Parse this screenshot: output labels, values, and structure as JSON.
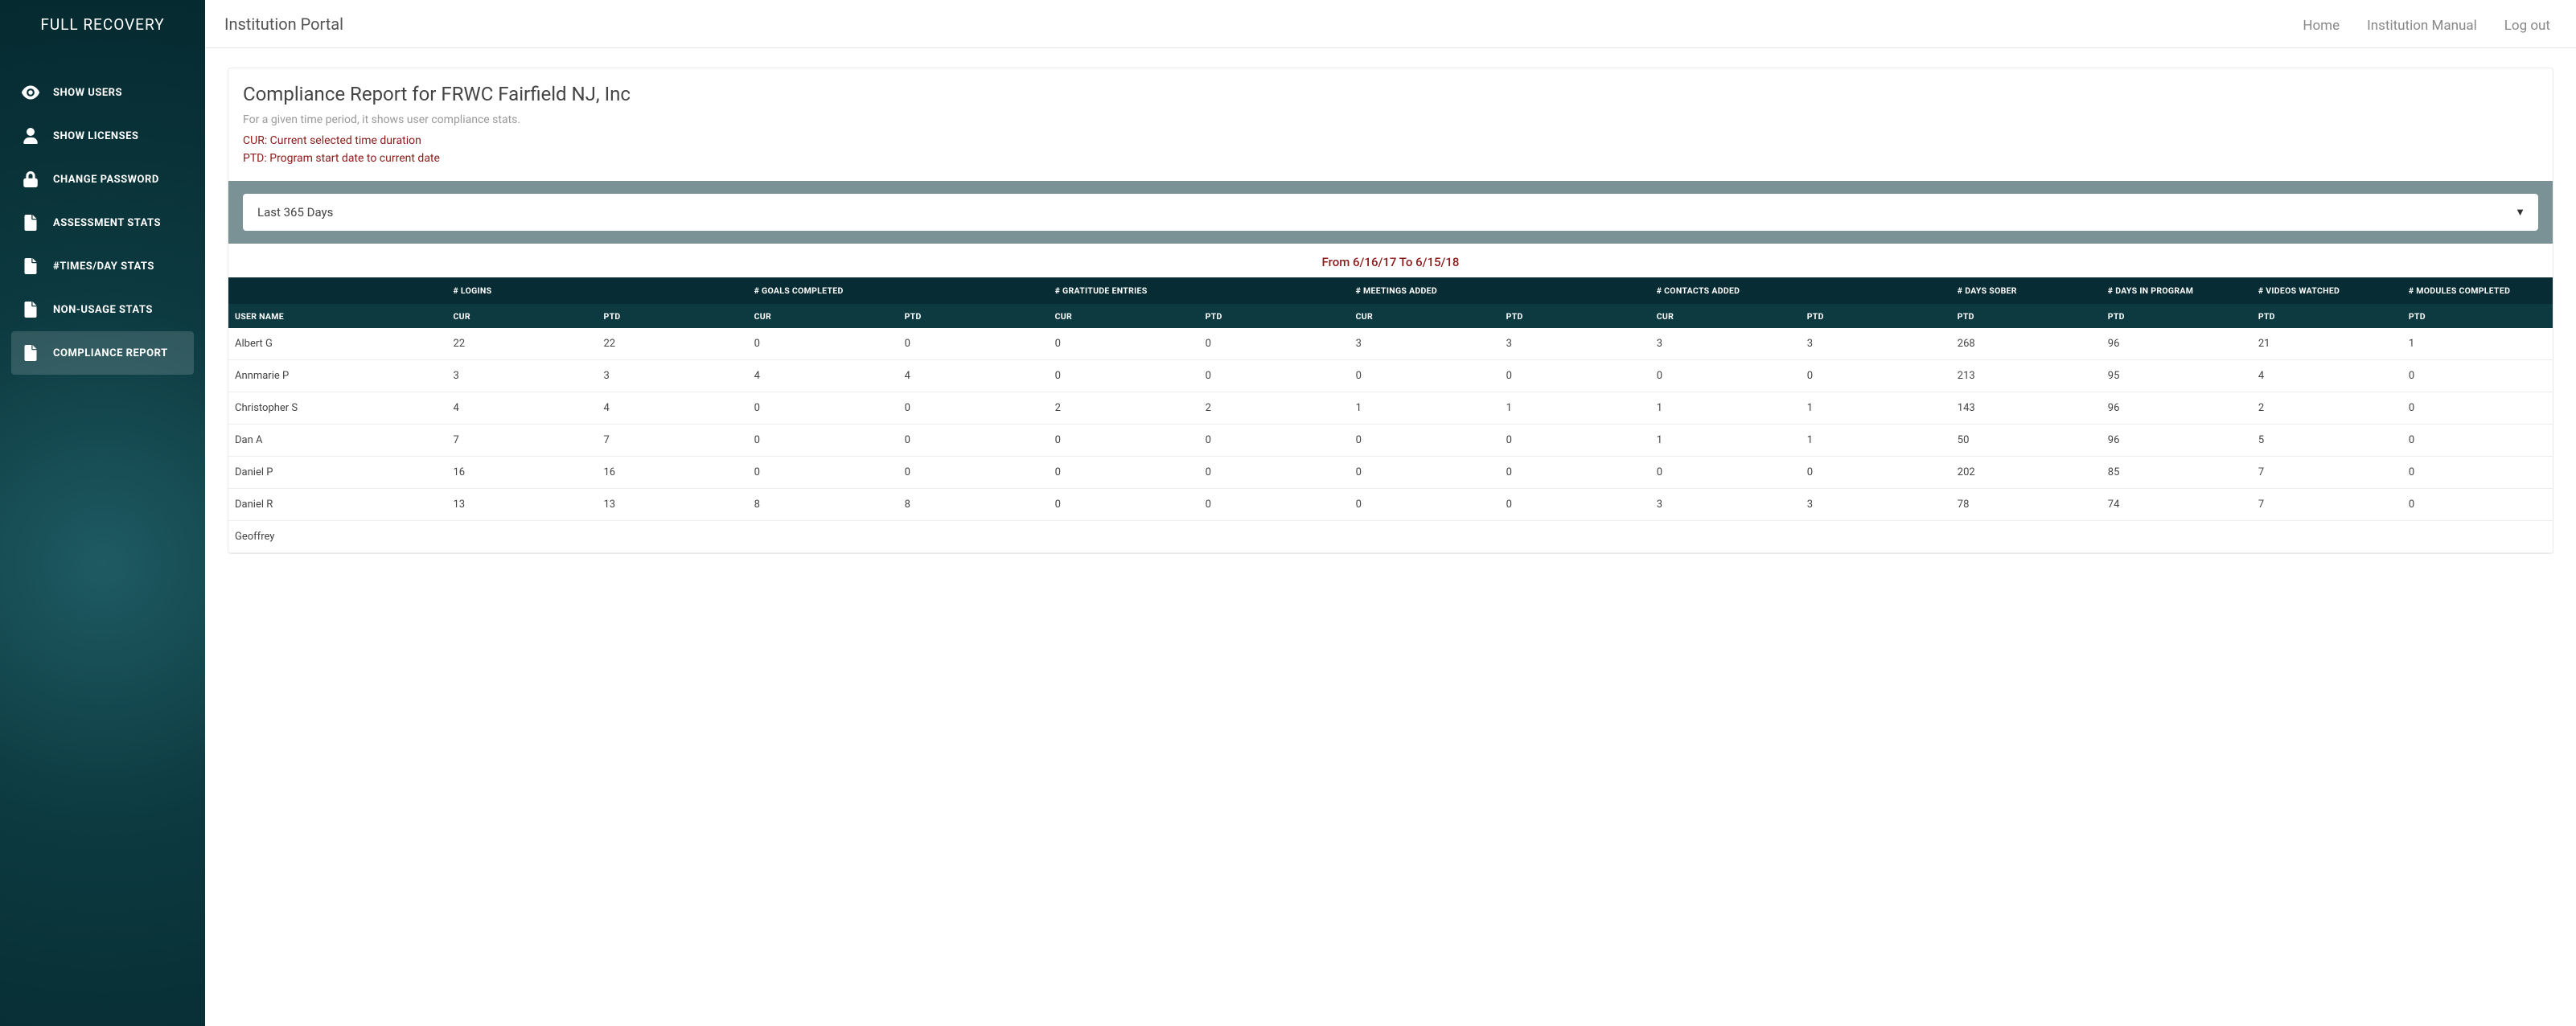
{
  "brand": "FULL RECOVERY",
  "sidebar": {
    "items": [
      {
        "label": "SHOW USERS",
        "icon": "eye-icon"
      },
      {
        "label": "SHOW LICENSES",
        "icon": "user-icon"
      },
      {
        "label": "CHANGE PASSWORD",
        "icon": "lock-icon"
      },
      {
        "label": "ASSESSMENT STATS",
        "icon": "file-icon"
      },
      {
        "label": "#TIMES/DAY STATS",
        "icon": "file-icon"
      },
      {
        "label": "NON-USAGE STATS",
        "icon": "file-icon"
      },
      {
        "label": "COMPLIANCE REPORT",
        "icon": "file-icon"
      }
    ],
    "activeIndex": 6
  },
  "topbar": {
    "title": "Institution Portal",
    "links": [
      "Home",
      "Institution Manual",
      "Log out"
    ]
  },
  "panel": {
    "title": "Compliance Report for FRWC Fairfield NJ, Inc",
    "subtitle": "For a given time period, it shows user compliance stats.",
    "legend_cur": "CUR: Current selected time duration",
    "legend_ptd": "PTD: Program start date to current date",
    "selector_value": "Last 365 Days",
    "range": "From 6/16/17 To 6/15/18"
  },
  "table": {
    "group_headers": [
      "",
      "# LOGINS",
      "# GOALS COMPLETED",
      "# GRATITUDE ENTRIES",
      "# MEETINGS ADDED",
      "# CONTACTS ADDED",
      "# DAYS SOBER",
      "# DAYS IN PROGRAM",
      "# VIDEOS WATCHED",
      "# MODULES COMPLETED"
    ],
    "sub_headers": [
      "USER NAME",
      "CUR",
      "PTD",
      "CUR",
      "PTD",
      "CUR",
      "PTD",
      "CUR",
      "PTD",
      "CUR",
      "PTD",
      "PTD",
      "PTD",
      "PTD",
      "PTD"
    ],
    "rows": [
      {
        "name": "Albert G",
        "v": [
          "22",
          "22",
          "0",
          "0",
          "0",
          "0",
          "3",
          "3",
          "3",
          "3",
          "268",
          "96",
          "21",
          "1"
        ]
      },
      {
        "name": "Annmarie P",
        "v": [
          "3",
          "3",
          "4",
          "4",
          "0",
          "0",
          "0",
          "0",
          "0",
          "0",
          "213",
          "95",
          "4",
          "0"
        ]
      },
      {
        "name": "Christopher S",
        "v": [
          "4",
          "4",
          "0",
          "0",
          "2",
          "2",
          "1",
          "1",
          "1",
          "1",
          "143",
          "96",
          "2",
          "0"
        ]
      },
      {
        "name": "Dan A",
        "v": [
          "7",
          "7",
          "0",
          "0",
          "0",
          "0",
          "0",
          "0",
          "1",
          "1",
          "50",
          "96",
          "5",
          "0"
        ]
      },
      {
        "name": "Daniel P",
        "v": [
          "16",
          "16",
          "0",
          "0",
          "0",
          "0",
          "0",
          "0",
          "0",
          "0",
          "202",
          "85",
          "7",
          "0"
        ]
      },
      {
        "name": "Daniel R",
        "v": [
          "13",
          "13",
          "8",
          "8",
          "0",
          "0",
          "0",
          "0",
          "3",
          "3",
          "78",
          "74",
          "7",
          "0"
        ]
      },
      {
        "name": "Geoffrey",
        "v": [
          "",
          "",
          "",
          "",
          "",
          "",
          "",
          "",
          "",
          "",
          "",
          "",
          "",
          ""
        ]
      }
    ]
  }
}
